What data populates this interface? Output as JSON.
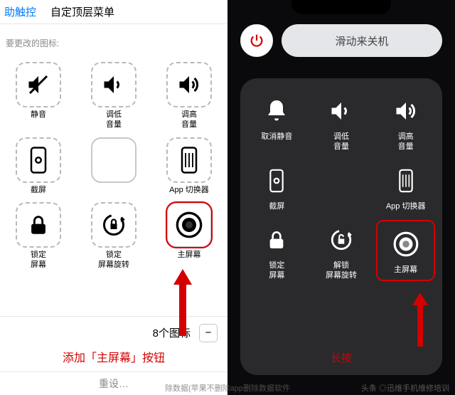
{
  "left": {
    "back": "助触控",
    "title": "自定顶层菜单",
    "subtitle": "要更改的图标:",
    "items": [
      {
        "label": "静音"
      },
      {
        "label": "调低\n音量"
      },
      {
        "label": "调高\n音量"
      },
      {
        "label": "截屏"
      },
      {
        "label": ""
      },
      {
        "label": "App 切换器"
      },
      {
        "label": "锁定\n屏幕"
      },
      {
        "label": "锁定\n屏幕旋转"
      },
      {
        "label": "主屏幕"
      }
    ],
    "count_text": "8个图标",
    "reset": "重设…",
    "annotation": "添加「主屏幕」按钮"
  },
  "right": {
    "slide_text": "滑动来关机",
    "items": [
      {
        "label": "取消静音"
      },
      {
        "label": "调低\n音量"
      },
      {
        "label": "调高\n音量"
      },
      {
        "label": "截屏"
      },
      {
        "label": ""
      },
      {
        "label": "App 切换器"
      },
      {
        "label": "锁定\n屏幕"
      },
      {
        "label": "解锁\n屏幕旋转"
      },
      {
        "label": "主屏幕"
      }
    ],
    "annotation": "长按"
  },
  "watermark_center": "除数据(苹果不删除app删除数据软件",
  "watermark_right": "头条 ◎迅维手机维修培训"
}
